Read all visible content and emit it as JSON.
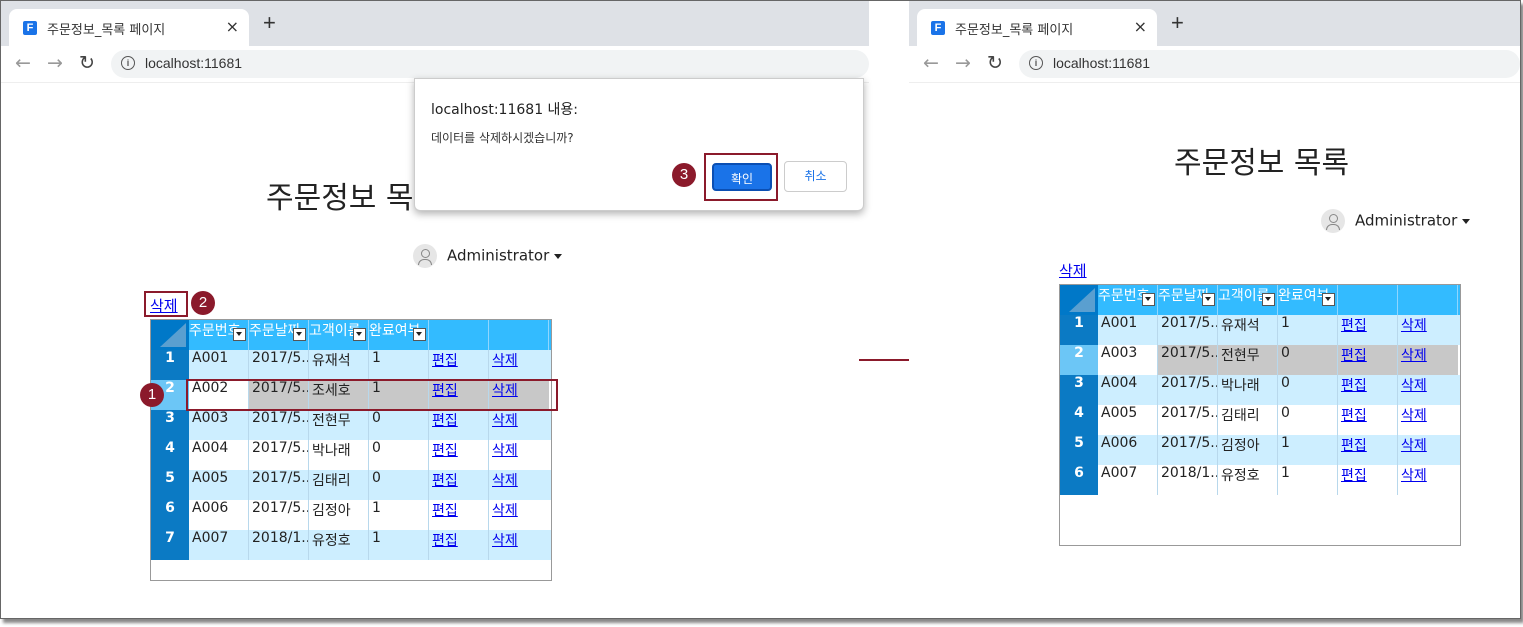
{
  "browser": {
    "tab_title": "주문정보_목록 페이지",
    "favicon_letter": "F",
    "close_glyph": "×",
    "new_tab_glyph": "+",
    "back_glyph": "←",
    "forward_glyph": "→",
    "reload_glyph": "↻",
    "info_glyph": "i",
    "url": "localhost:11681"
  },
  "page": {
    "title": "주문정보 목록",
    "title_visible_left": "주문정보 목",
    "user": "Administrator",
    "delete_link": "삭제"
  },
  "grid": {
    "headers": [
      "주문번호",
      "주문날짜",
      "고객이름",
      "완료여부",
      "",
      ""
    ],
    "edit_label": "편집",
    "delete_label": "삭제"
  },
  "before_rows": [
    {
      "num": "1",
      "id": "A001",
      "date": "2017/5...",
      "name": "유재석",
      "done": "1"
    },
    {
      "num": "2",
      "id": "A002",
      "date": "2017/5...",
      "name": "조세호",
      "done": "1"
    },
    {
      "num": "3",
      "id": "A003",
      "date": "2017/5...",
      "name": "전현무",
      "done": "0"
    },
    {
      "num": "4",
      "id": "A004",
      "date": "2017/5...",
      "name": "박나래",
      "done": "0"
    },
    {
      "num": "5",
      "id": "A005",
      "date": "2017/5...",
      "name": "김태리",
      "done": "0"
    },
    {
      "num": "6",
      "id": "A006",
      "date": "2017/5...",
      "name": "김정아",
      "done": "1"
    },
    {
      "num": "7",
      "id": "A007",
      "date": "2018/1...",
      "name": "유정호",
      "done": "1"
    }
  ],
  "after_rows": [
    {
      "num": "1",
      "id": "A001",
      "date": "2017/5...",
      "name": "유재석",
      "done": "1"
    },
    {
      "num": "2",
      "id": "A003",
      "date": "2017/5...",
      "name": "전현무",
      "done": "0"
    },
    {
      "num": "3",
      "id": "A004",
      "date": "2017/5...",
      "name": "박나래",
      "done": "0"
    },
    {
      "num": "4",
      "id": "A005",
      "date": "2017/5...",
      "name": "김태리",
      "done": "0"
    },
    {
      "num": "5",
      "id": "A006",
      "date": "2017/5...",
      "name": "김정아",
      "done": "1"
    },
    {
      "num": "6",
      "id": "A007",
      "date": "2018/1...",
      "name": "유정호",
      "done": "1"
    }
  ],
  "dialog": {
    "title": "localhost:11681 내용:",
    "message": "데이터를 삭제하시겠습니까?",
    "ok": "확인",
    "cancel": "취소"
  },
  "steps": [
    "1",
    "2",
    "3"
  ],
  "colors": {
    "header": "#33bbff",
    "row_header": "#0b7ac4",
    "light_row": "#cdeeff",
    "selected_row": "#c8c8c8",
    "annotation": "#8b1a2b"
  }
}
